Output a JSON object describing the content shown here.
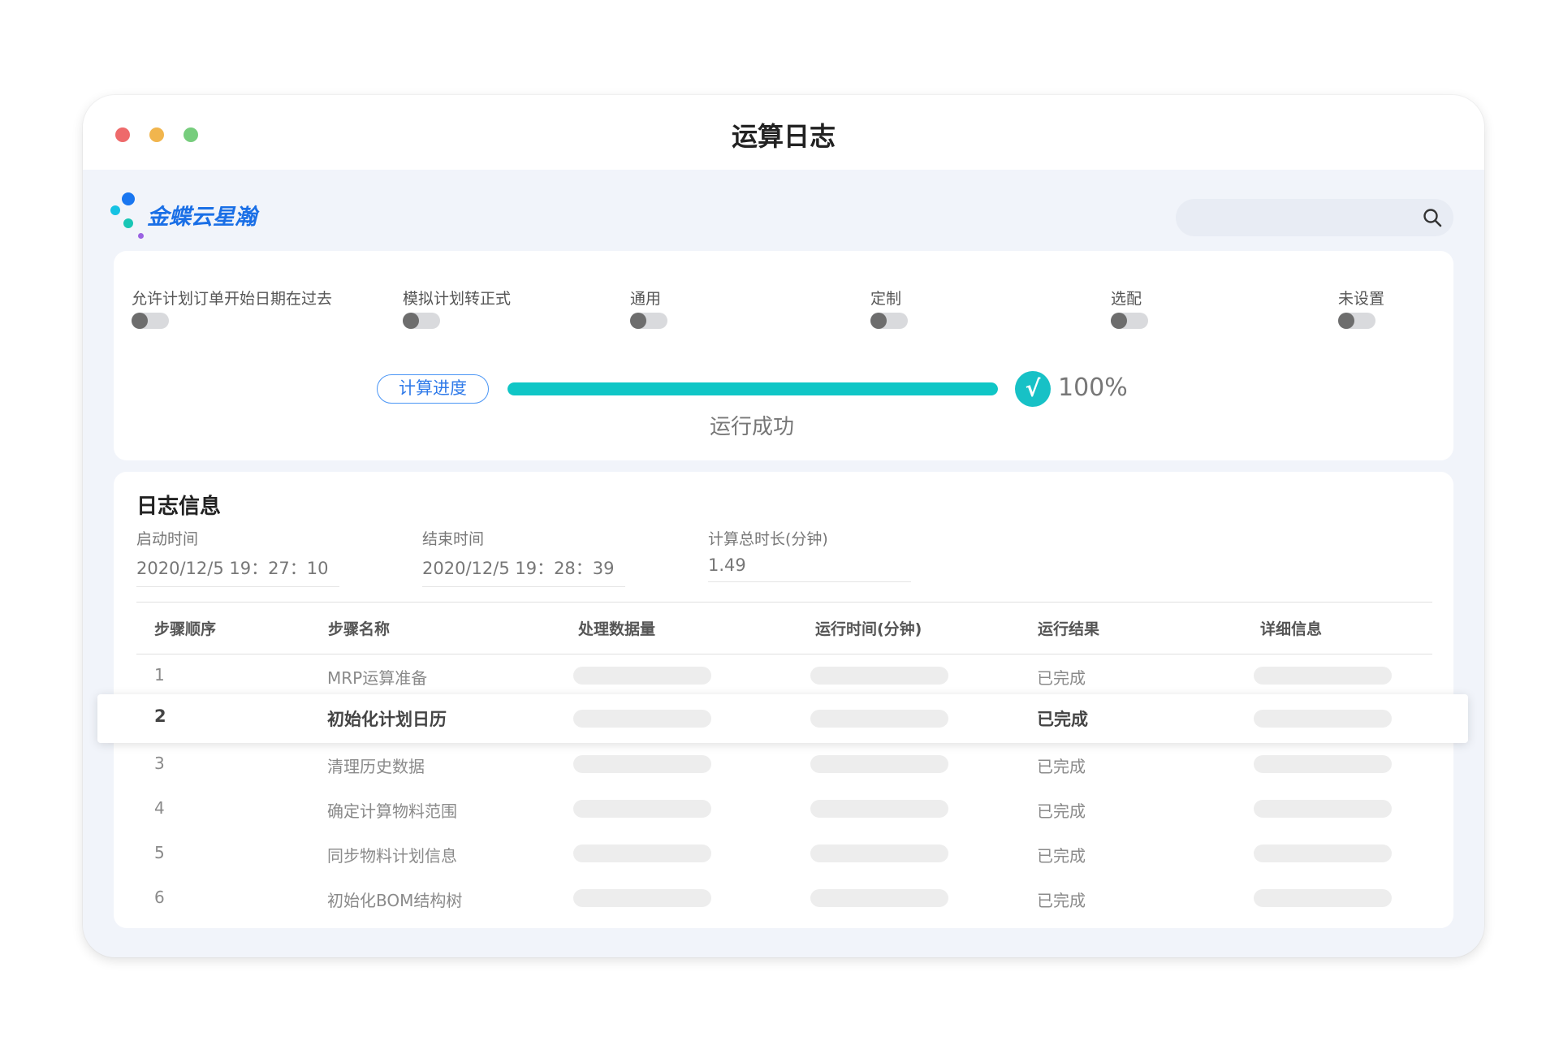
{
  "window": {
    "title": "运算日志"
  },
  "brand": {
    "logo_text": "金蝶云星瀚"
  },
  "search": {
    "icon": "search-icon"
  },
  "options": [
    {
      "label": "允许计划订单开始日期在过去",
      "enabled": false
    },
    {
      "label": "模拟计划转正式",
      "enabled": false
    },
    {
      "label": "通用",
      "enabled": false
    },
    {
      "label": "定制",
      "enabled": false
    },
    {
      "label": "选配",
      "enabled": false
    },
    {
      "label": "未设置",
      "enabled": false
    }
  ],
  "progress": {
    "label": "计算进度",
    "value": 100,
    "percent_text": "100%",
    "status": "运行成功",
    "check_glyph": "√",
    "color": "#0fc6c6"
  },
  "log": {
    "title": "日志信息",
    "start": {
      "label": "启动时间",
      "value": "2020/12/5 19：27：10"
    },
    "end": {
      "label": "结束时间",
      "value": "2020/12/5 19：28：39"
    },
    "duration": {
      "label": "计算总时长(分钟)",
      "value": "1.49"
    },
    "columns": [
      "步骤顺序",
      "步骤名称",
      "处理数据量",
      "运行时间(分钟)",
      "运行结果",
      "详细信息"
    ],
    "rows": [
      {
        "order": "1",
        "name": "MRP运算准备",
        "result": "已完成"
      },
      {
        "order": "2",
        "name": "初始化计划日历",
        "result": "已完成"
      },
      {
        "order": "3",
        "name": "清理历史数据",
        "result": "已完成"
      },
      {
        "order": "4",
        "name": "确定计算物料范围",
        "result": "已完成"
      },
      {
        "order": "5",
        "name": "同步物料计划信息",
        "result": "已完成"
      },
      {
        "order": "6",
        "name": "初始化BOM结构树",
        "result": "已完成"
      }
    ]
  }
}
